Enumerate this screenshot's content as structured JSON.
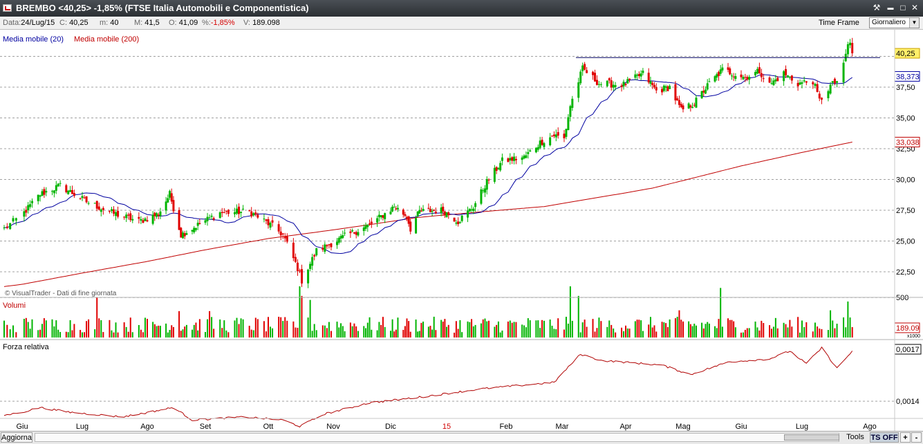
{
  "window": {
    "title": "BREMBO <40,25> -1,85%  (FTSE Italia Automobili e Componentistica)"
  },
  "window_buttons": {
    "tools": "⚒",
    "minimize": "▬",
    "maximize": "□",
    "close": "✕"
  },
  "infobar": {
    "date_label": "Data:",
    "date": "24/Lug/15",
    "close_label": "C:",
    "close": "40,25",
    "min_label": "m:",
    "min": "40",
    "max_label": "M:",
    "max": "41,5",
    "open_label": "O:",
    "open": "41,09",
    "pct_label": "%:",
    "pct": "-1,85%",
    "vol_label": "V:",
    "vol": "189.098",
    "timeframe_label": "Time Frame",
    "timeframe_value": "Giornaliero"
  },
  "bottombar": {
    "refresh_label": "Aggiorna",
    "tools_label": "Tools",
    "ts_label": "TS OFF",
    "plus_label": "+",
    "minus_label": "-"
  },
  "colors": {
    "up": "#00b400",
    "down": "#e00000",
    "ma20": "#0000a0",
    "ma200": "#c00000",
    "rs": "#b00000",
    "grid": "#a0a0a0",
    "volume_label": "#c00000"
  },
  "chart_data": {
    "type": "candlestick",
    "watermark": "© VisualTrader - Dati di fine giornata",
    "x_ticks": [
      "Giu",
      "Lug",
      "Ago",
      "Set",
      "Ott",
      "Nov",
      "Dic",
      "15",
      "Feb",
      "Mar",
      "Apr",
      "Mag",
      "Giu",
      "Lug",
      "Ago"
    ],
    "x_tick_highlight": "15",
    "price": {
      "y_ticks": [
        "22,50",
        "25,00",
        "27,50",
        "30,00",
        "32,50",
        "35,00",
        "37,50"
      ],
      "ylim": [
        21,
        42.2
      ],
      "last_close_label": "40,25",
      "ma20_last_label": "38,373",
      "ma200_last_label": "33,038",
      "resistance_level": 39.9,
      "resistance_range": [
        "2015-03-01",
        "2015-07-31"
      ],
      "legend": [
        "Media mobile (20)",
        "Media mobile (200)"
      ],
      "anchors": [
        [
          "2014-05-26",
          26.0
        ],
        [
          "2014-06-03",
          27.5
        ],
        [
          "2014-06-10",
          28.8
        ],
        [
          "2014-06-20",
          29.5
        ],
        [
          "2014-07-03",
          28.2
        ],
        [
          "2014-07-15",
          27.3
        ],
        [
          "2014-07-28",
          26.6
        ],
        [
          "2014-08-07",
          27.2
        ],
        [
          "2014-08-13",
          28.8
        ],
        [
          "2014-08-19",
          25.5
        ],
        [
          "2014-08-28",
          26.3
        ],
        [
          "2014-09-08",
          27.3
        ],
        [
          "2014-09-22",
          27.4
        ],
        [
          "2014-10-03",
          26.2
        ],
        [
          "2014-10-08",
          25.5
        ],
        [
          "2014-10-15",
          22.8
        ],
        [
          "2014-10-17",
          21.8
        ],
        [
          "2014-10-24",
          24.2
        ],
        [
          "2014-11-06",
          25.3
        ],
        [
          "2014-11-20",
          26.3
        ],
        [
          "2014-12-03",
          27.8
        ],
        [
          "2014-12-10",
          27.0
        ],
        [
          "2014-12-12",
          26.0
        ],
        [
          "2014-12-17",
          27.4
        ],
        [
          "2014-12-30",
          27.5
        ],
        [
          "2015-01-07",
          26.6
        ],
        [
          "2015-01-15",
          27.8
        ],
        [
          "2015-01-22",
          29.8
        ],
        [
          "2015-01-30",
          31.5
        ],
        [
          "2015-02-10",
          31.8
        ],
        [
          "2015-02-18",
          33.0
        ],
        [
          "2015-02-25",
          33.6
        ],
        [
          "2015-03-02",
          33.3
        ],
        [
          "2015-03-05",
          36.0
        ],
        [
          "2015-03-11",
          39.0
        ],
        [
          "2015-03-19",
          37.8
        ],
        [
          "2015-03-31",
          37.7
        ],
        [
          "2015-04-10",
          38.6
        ],
        [
          "2015-04-17",
          37.2
        ],
        [
          "2015-04-24",
          37.5
        ],
        [
          "2015-04-30",
          35.6
        ],
        [
          "2015-05-07",
          36.2
        ],
        [
          "2015-05-15",
          37.8
        ],
        [
          "2015-05-22",
          38.9
        ],
        [
          "2015-06-03",
          38.3
        ],
        [
          "2015-06-10",
          38.8
        ],
        [
          "2015-06-15",
          37.7
        ],
        [
          "2015-06-22",
          38.6
        ],
        [
          "2015-06-29",
          37.8
        ],
        [
          "2015-07-06",
          38.0
        ],
        [
          "2015-07-09",
          36.4
        ],
        [
          "2015-07-14",
          37.6
        ],
        [
          "2015-07-17",
          38.0
        ],
        [
          "2015-07-20",
          39.2
        ],
        [
          "2015-07-22",
          41.0
        ],
        [
          "2015-07-23",
          41.0
        ],
        [
          "2015-07-24",
          40.25
        ]
      ],
      "ma200_anchors": [
        [
          "2014-05-26",
          21.3
        ],
        [
          "2014-10-01",
          25.2
        ],
        [
          "2014-12-15",
          26.9
        ],
        [
          "2015-02-20",
          27.8
        ],
        [
          "2015-04-15",
          29.3
        ],
        [
          "2015-06-01",
          31.1
        ],
        [
          "2015-07-24",
          33.038
        ]
      ]
    },
    "volume": {
      "label": "Volumi",
      "y_ticks": [
        "500"
      ],
      "last_label": "189.09",
      "multiplier_label": "x1000",
      "max": 640,
      "spikes": [
        [
          "2014-07-08",
          500
        ],
        [
          "2014-08-18",
          330
        ],
        [
          "2014-09-03",
          330
        ],
        [
          "2014-10-16",
          640
        ],
        [
          "2014-10-17",
          520
        ],
        [
          "2014-10-21",
          470
        ],
        [
          "2015-03-05",
          640
        ],
        [
          "2015-03-09",
          520
        ],
        [
          "2015-04-29",
          340
        ],
        [
          "2015-05-21",
          620
        ],
        [
          "2015-07-14",
          340
        ],
        [
          "2015-07-22",
          450
        ]
      ]
    },
    "relative_strength": {
      "label": "Forza relativa",
      "y_ticks": [
        "0,0017",
        "0,0014"
      ],
      "ylim": [
        0.00122,
        0.00178
      ],
      "anchors": [
        [
          "2014-05-26",
          0.00131
        ],
        [
          "2014-06-10",
          0.00136
        ],
        [
          "2014-06-25",
          0.00133
        ],
        [
          "2014-07-20",
          0.0013
        ],
        [
          "2014-08-15",
          0.00136
        ],
        [
          "2014-08-25",
          0.00128
        ],
        [
          "2014-09-20",
          0.0013
        ],
        [
          "2014-10-08",
          0.00128
        ],
        [
          "2014-10-16",
          0.00124
        ],
        [
          "2014-10-28",
          0.00132
        ],
        [
          "2014-11-20",
          0.00139
        ],
        [
          "2014-12-20",
          0.00143
        ],
        [
          "2015-01-20",
          0.00148
        ],
        [
          "2015-02-25",
          0.00152
        ],
        [
          "2015-03-10",
          0.0017
        ],
        [
          "2015-03-20",
          0.00166
        ],
        [
          "2015-04-20",
          0.00163
        ],
        [
          "2015-05-05",
          0.00157
        ],
        [
          "2015-05-25",
          0.00165
        ],
        [
          "2015-06-15",
          0.00167
        ],
        [
          "2015-06-25",
          0.00172
        ],
        [
          "2015-07-03",
          0.00164
        ],
        [
          "2015-07-10",
          0.00174
        ],
        [
          "2015-07-17",
          0.00161
        ],
        [
          "2015-07-24",
          0.00172
        ]
      ]
    }
  }
}
